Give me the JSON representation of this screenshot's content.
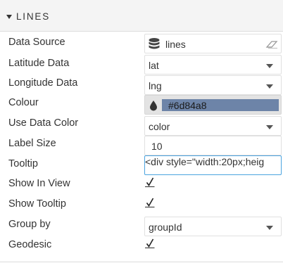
{
  "section": {
    "title": "LINES"
  },
  "rows": {
    "data_source": {
      "label": "Data Source",
      "value": "lines",
      "icon": "database-icon",
      "clear_icon": "eraser-icon"
    },
    "latitude": {
      "label": "Latitude Data",
      "value": "lat"
    },
    "longitude": {
      "label": "Longitude Data",
      "value": "lng"
    },
    "colour": {
      "label": "Colour",
      "value": "#6d84a8",
      "swatch_color": "#6d84a8",
      "icon": "color-drop-icon"
    },
    "use_data_color": {
      "label": "Use Data Color",
      "value": "color"
    },
    "label_size": {
      "label": "Label Size",
      "value": "10"
    },
    "tooltip": {
      "label": "Tooltip",
      "value": "<div style=\"width:20px;heig"
    },
    "show_in_view": {
      "label": "Show In View",
      "checked": true
    },
    "show_tooltip": {
      "label": "Show Tooltip",
      "checked": true
    },
    "group_by": {
      "label": "Group by",
      "value": "groupId"
    },
    "geodesic": {
      "label": "Geodesic",
      "checked": true
    }
  },
  "colors": {
    "accent_focus": "#4aa3df",
    "header_bg": "#f4f4f4",
    "swatch": "#6d84a8"
  }
}
